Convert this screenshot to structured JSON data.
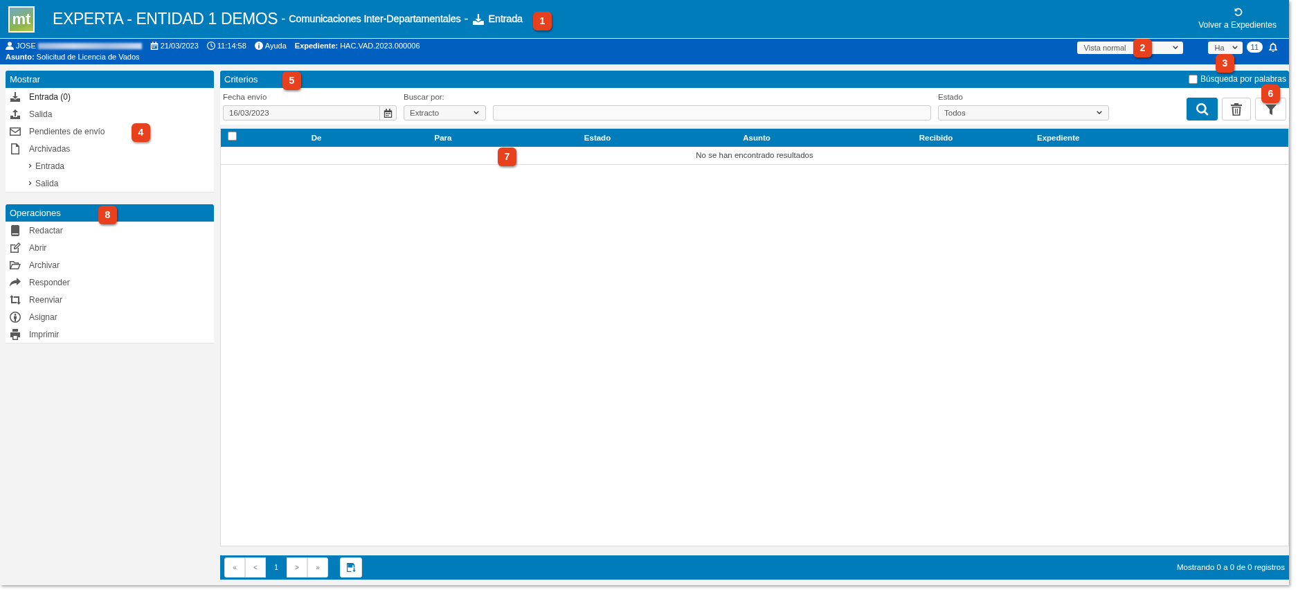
{
  "header": {
    "logo_text": "mt",
    "app_title": "EXPERTA - ENTIDAD 1 DEMOS",
    "separator_1": "-",
    "module": "Comunicaciones Inter-Departamentales",
    "separator_2": "-",
    "section": "Entrada",
    "back_button": "Volver a Expedientes"
  },
  "info_bar": {
    "user": "JOSE",
    "date": "21/03/2023",
    "time": "11:14:58",
    "help": "Ayuda",
    "expediente_label": "Expediente:",
    "expediente": "HAC.VAD.2023.000006",
    "asunto_label": "Asunto:",
    "asunto": "Solicitud de Licencia de Vados",
    "view_select": "Vista normal",
    "lang_select": "Ha",
    "notifications": "11"
  },
  "sidebar": {
    "show_panel": {
      "title": "Mostrar",
      "items": [
        {
          "label": "Entrada (0)",
          "selected": true
        },
        {
          "label": "Salida",
          "selected": false
        },
        {
          "label": "Pendientes de envío",
          "selected": false
        },
        {
          "label": "Archivadas",
          "selected": false,
          "children": [
            {
              "label": "Entrada",
              "selected": false
            },
            {
              "label": "Salida",
              "selected": false
            }
          ]
        }
      ]
    },
    "operations_panel": {
      "title": "Operaciones",
      "items": [
        "Redactar",
        "Abrir",
        "Archivar",
        "Responder",
        "Reenviar",
        "Asignar",
        "Imprimir"
      ]
    }
  },
  "criteria": {
    "title": "Criterios",
    "word_search": {
      "label": "Búsqueda por palabras",
      "checked": false
    },
    "date": {
      "label": "Fecha envío",
      "value": "16/03/2023"
    },
    "search_by": {
      "label": "Buscar por:",
      "value": "Extracto"
    },
    "state": {
      "label": "Estado",
      "value": "Todos"
    }
  },
  "table": {
    "select_all_checked": false,
    "columns": [
      "De",
      "Para",
      "Estado",
      "Asunto",
      "Recibido",
      "Expediente"
    ],
    "empty_message": "No se han encontrado resultados"
  },
  "pagination": {
    "pages": [
      {
        "label": "«",
        "selected": false
      },
      {
        "label": "<",
        "selected": false
      },
      {
        "label": "1",
        "selected": true
      },
      {
        "label": ">",
        "selected": false
      },
      {
        "label": "»",
        "selected": false
      }
    ],
    "summary": "Mostrando 0 a 0 de 0 registros"
  },
  "callouts": [
    "1",
    "2",
    "3",
    "4",
    "5",
    "6",
    "7",
    "8"
  ]
}
